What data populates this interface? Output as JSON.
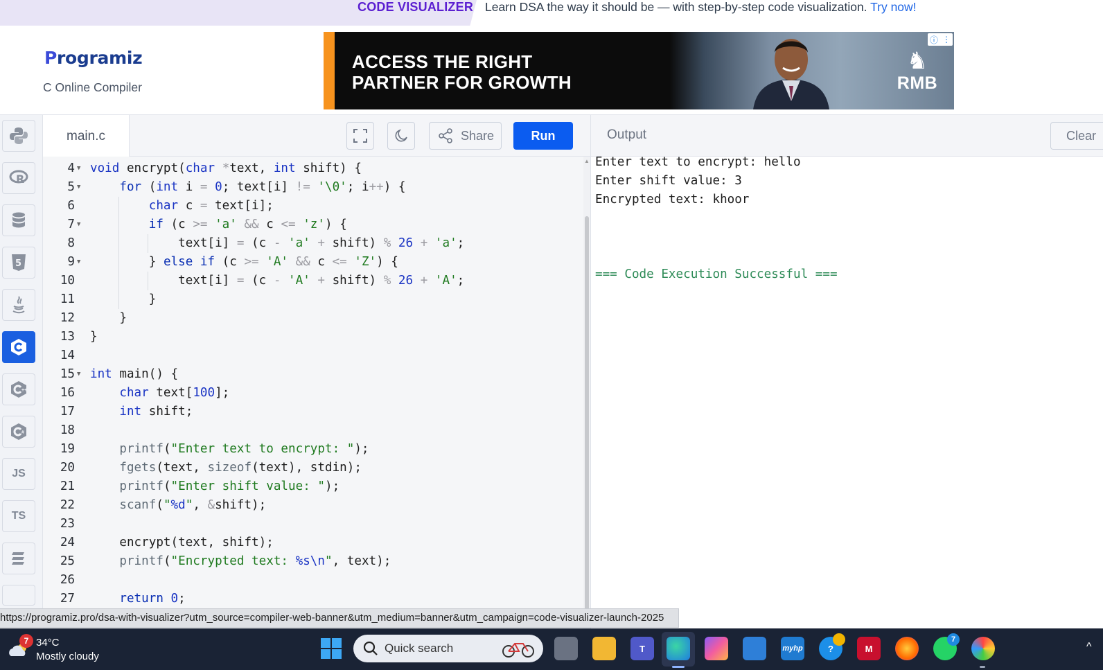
{
  "promo": {
    "tag": "CODE VISUALIZER",
    "text": "Learn DSA the way it should be — with step-by-step code visualization.",
    "link": "Try now!"
  },
  "header": {
    "logo_first": "P",
    "logo_rest": "rogramiz",
    "subtitle": "C Online Compiler"
  },
  "ad": {
    "line1": "ACCESS THE RIGHT",
    "line2": "PARTNER FOR GROWTH",
    "brand": "RMB"
  },
  "rail": {
    "items": [
      {
        "name": "python",
        "label": ""
      },
      {
        "name": "r",
        "label": "R"
      },
      {
        "name": "sql",
        "label": ""
      },
      {
        "name": "html",
        "label": "5"
      },
      {
        "name": "java",
        "label": ""
      },
      {
        "name": "c",
        "label": "C"
      },
      {
        "name": "cpp",
        "label": "C"
      },
      {
        "name": "csharp",
        "label": "C"
      },
      {
        "name": "js",
        "label": "JS"
      },
      {
        "name": "ts",
        "label": "TS"
      },
      {
        "name": "swift",
        "label": ""
      }
    ]
  },
  "editor": {
    "filename": "main.c",
    "share_label": "Share",
    "run_label": "Run",
    "line_numbers": [
      "4",
      "5",
      "6",
      "7",
      "8",
      "9",
      "10",
      "11",
      "12",
      "13",
      "14",
      "15",
      "16",
      "17",
      "18",
      "19",
      "20",
      "21",
      "22",
      "23",
      "24",
      "25",
      "26",
      "27"
    ]
  },
  "output": {
    "title": "Output",
    "clear_label": "Clear",
    "lines": [
      "Enter text to encrypt: hello",
      "Enter shift value: 3",
      "Encrypted text: khoor"
    ],
    "status": "=== Code Execution Successful ==="
  },
  "status_url": "https://programiz.pro/dsa-with-visualizer?utm_source=compiler-web-banner&utm_medium=banner&utm_campaign=code-visualizer-launch-2025",
  "taskbar": {
    "weather_badge": "7",
    "temperature": "34°C",
    "condition": "Mostly cloudy",
    "search_placeholder": "Quick search",
    "whatsapp_badge": "7",
    "myhp_label": "myhp"
  },
  "colors": {
    "accent": "#0b5cf0",
    "promo_purple": "#5b1fd1",
    "success_green": "#2e8b57"
  }
}
